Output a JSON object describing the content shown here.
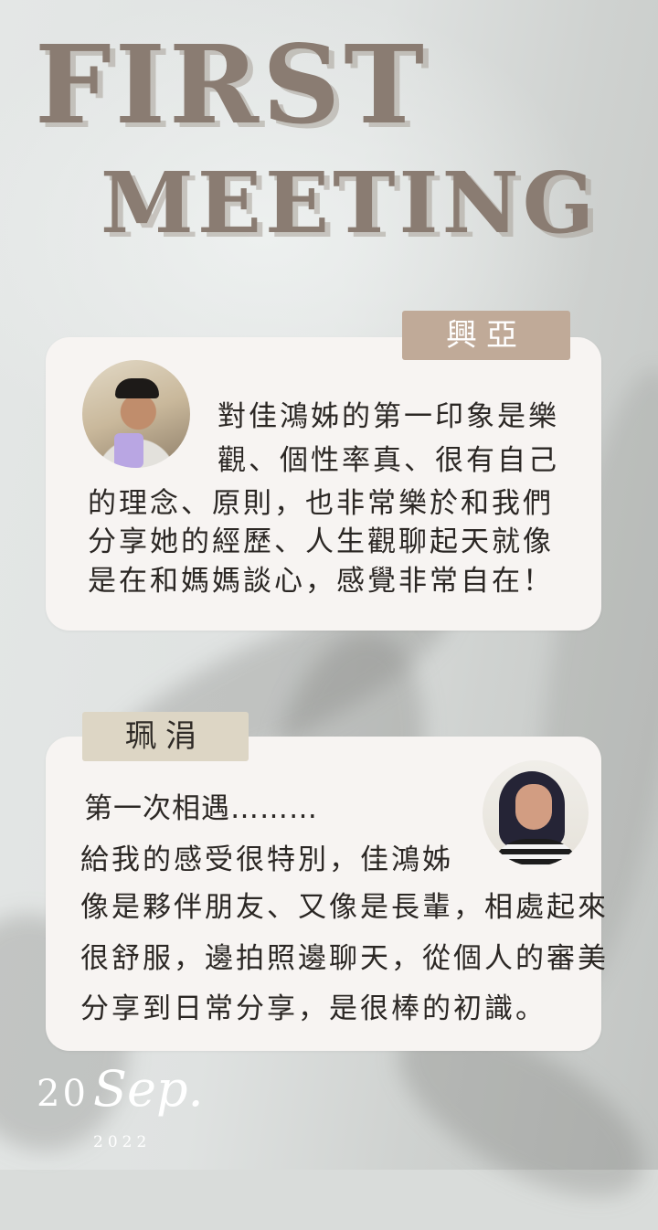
{
  "title": {
    "line1": "FIRST",
    "line2": "MEETING"
  },
  "card1": {
    "name": "興亞",
    "lines": [
      "對佳鴻姊的第一印象是樂",
      "觀、個性率真、很有自己",
      "的理念、原則，也非常樂於和我們",
      "分享她的經歷、人生觀聊起天就像",
      "是在和媽媽談心，感覺非常自在！"
    ]
  },
  "card2": {
    "name": "珮涓",
    "lines": [
      "第一次相遇………",
      "給我的感受很特別，佳鴻姊",
      "像是夥伴朋友、又像是長輩，相處起來",
      "很舒服，邊拍照邊聊天，從個人的審美",
      "分享到日常分享，是很棒的初識。"
    ]
  },
  "date": {
    "day": "20",
    "month": "Sep.",
    "year": "2022"
  },
  "colors": {
    "title": "#8a7c72",
    "card": "#f7f4f2",
    "tag1": "#c0aa98",
    "tag2": "#ddd6c5"
  }
}
